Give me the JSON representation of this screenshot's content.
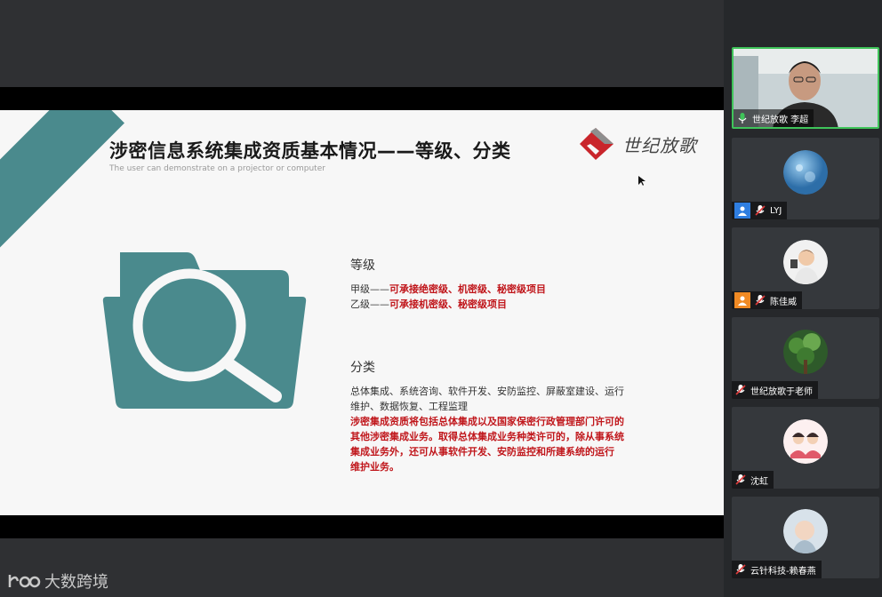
{
  "slide": {
    "title": "涉密信息系统集成资质基本情况——等级、分类",
    "subtitle": "The user can demonstrate on a projector or computer",
    "logo_text": "世纪放歌",
    "level_section": {
      "heading": "等级",
      "items": [
        {
          "label": "甲级——",
          "detail": "可承接绝密级、机密级、秘密级项目"
        },
        {
          "label": "乙级——",
          "detail": "可承接机密级、秘密级项目"
        }
      ]
    },
    "category_section": {
      "heading": "分类",
      "plain_lines": [
        "总体集成、系统咨询、软件开发、安防监控、屏蔽室建设、运行",
        "维护、数据恢复、工程监理"
      ],
      "red_lines": [
        "涉密集成资质将包括总体集成以及国家保密行政管理部门许可的",
        "其他涉密集成业务。取得总体集成业务种类许可的，除从事系统",
        "集成业务外，还可从事软件开发、安防监控和所建系统的运行",
        "维护业务。"
      ]
    }
  },
  "participants": [
    {
      "name": "世纪放歌 李超",
      "active": true,
      "mic": "on"
    },
    {
      "name": "LYJ",
      "active": false,
      "mic": "muted",
      "role": "user"
    },
    {
      "name": "陈佳威",
      "active": false,
      "mic": "muted",
      "role": "user-orange"
    },
    {
      "name": "世纪放歌于老师",
      "active": false,
      "mic": "muted"
    },
    {
      "name": "沈虹",
      "active": false,
      "mic": "muted"
    },
    {
      "name": "云针科技-赖春燕",
      "active": false,
      "mic": "muted"
    }
  ],
  "watermark": {
    "text": "大数跨境"
  },
  "colors": {
    "teal": "#4a8a8d",
    "red": "#c0161b",
    "active_border": "#3fc45a"
  }
}
